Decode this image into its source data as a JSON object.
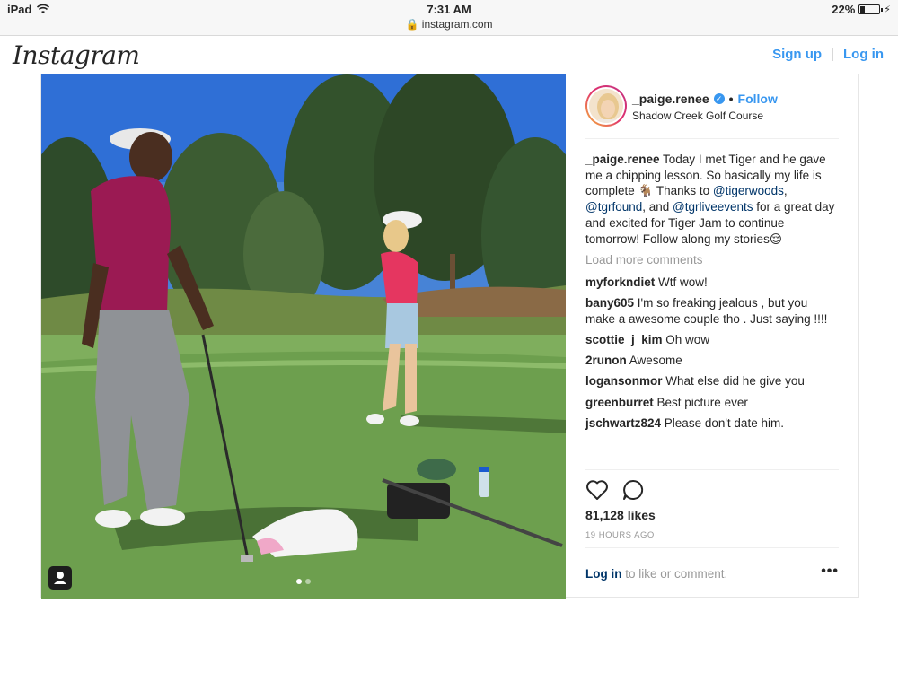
{
  "status_bar": {
    "device": "iPad",
    "time": "7:31 AM",
    "url": "instagram.com",
    "battery": "22%",
    "battery_level": 0.22
  },
  "header": {
    "logo": "Instagram",
    "sign_up": "Sign up",
    "separator": "|",
    "log_in": "Log in"
  },
  "post": {
    "username": "_paige.renee",
    "verified_mark": "✓",
    "bullet": "•",
    "follow": "Follow",
    "location": "Shadow Creek Golf Course",
    "caption": {
      "username": "_paige.renee",
      "text1": " Today I met Tiger and he gave me a chipping lesson. So basically my life is complete ",
      "emoji1": "🐐",
      "text2": " Thanks to ",
      "mention1": "@tigerwoods",
      "sep1": ", ",
      "mention2": "@tgrfound",
      "sep2": ", and ",
      "mention3": "@tgrliveevents",
      "text3": " for a great day and excited for Tiger Jam to continue tomorrow! Follow along my stories",
      "emoji2": "😌"
    },
    "load_more": "Load more comments",
    "comments": [
      {
        "user": "myforkndiet",
        "text": " Wtf wow!"
      },
      {
        "user": "bany605",
        "text": " I'm so freaking jealous , but you make a awesome couple tho . Just saying !!!!"
      },
      {
        "user": "scottie_j_kim",
        "text": " Oh wow"
      },
      {
        "user": "2runon",
        "text": " Awesome"
      },
      {
        "user": "logansonmor",
        "text": " What else did he give you"
      },
      {
        "user": "greenburret",
        "text": " Best picture ever"
      },
      {
        "user": "jschwartz824",
        "text": " Please don't date him."
      }
    ],
    "likes": "81,128 likes",
    "time_ago": "19 HOURS AGO",
    "login_link": "Log in",
    "login_suffix": " to like or comment.",
    "more_options": "•••",
    "icons": [
      "heart-icon",
      "comment-icon",
      "user-tag-icon"
    ]
  },
  "colors": {
    "accent": "#3897f0",
    "mention": "#003569",
    "muted": "#999999",
    "text": "#262626",
    "border": "#e6e6e6"
  }
}
